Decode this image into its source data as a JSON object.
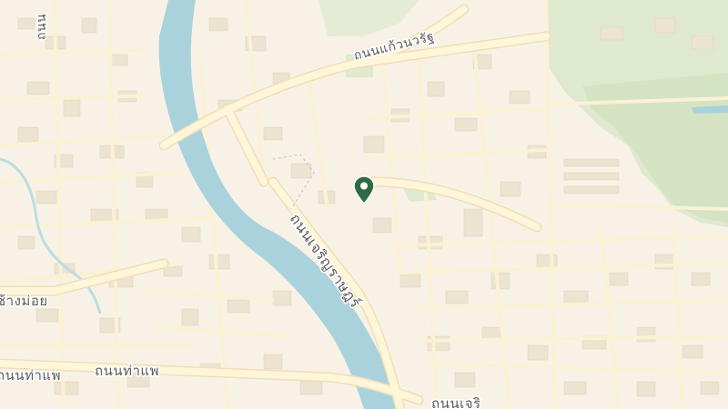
{
  "map": {
    "colors": {
      "land": "#f8f2e6",
      "water": "#a9d2dc",
      "park": "#dfe9cf",
      "road": "#fdf3d6",
      "road_casing": "#f1e2bc",
      "building": "#efe6d4",
      "marker": "#2f6b45"
    },
    "labels": {
      "kaew_nawarat_road": "ถนนแก้วนวรัฐ",
      "charoen_rat_road": "ถนนเจริญราษฎร์",
      "tha_phae_road_left": "ถนนท่าแพ",
      "tha_phae_road_right": "ถนนท่าแพ",
      "chang_moi_road": "ช้างม่อย",
      "road_top_left": "ถนน",
      "road_bottom_right": "ถนนเจริ"
    },
    "marker": {
      "icon": "map-pin-icon"
    }
  }
}
